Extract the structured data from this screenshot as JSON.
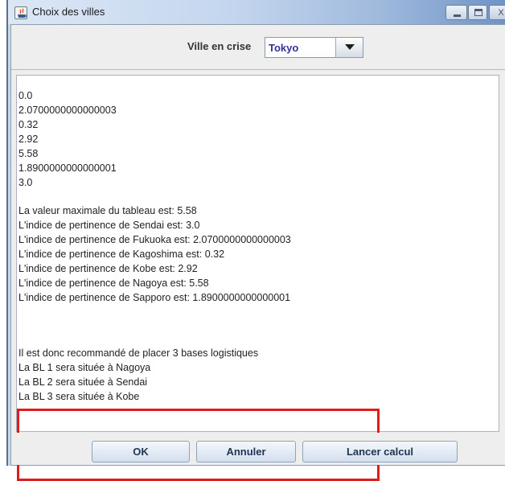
{
  "window": {
    "title": "Choix des villes",
    "icon": "java-app-icon",
    "controls": {
      "minimize": "minimize-icon",
      "maximize": "maximize-icon",
      "close": "close-icon",
      "close_glyph": "X"
    }
  },
  "header": {
    "label": "Ville en crise",
    "city_select": {
      "value": "Tokyo",
      "icon": "chevron-down-icon"
    }
  },
  "output": {
    "lines": [
      "0.0",
      "2.0700000000000003",
      "0.32",
      "2.92",
      "5.58",
      "1.8900000000000001",
      "3.0",
      "",
      "La valeur maximale du tableau est: 5.58",
      "L'indice de pertinence de Sendai est: 3.0",
      "L'indice de pertinence de Fukuoka est: 2.0700000000000003",
      "L'indice de pertinence de Kagoshima est: 0.32",
      "L'indice de pertinence de Kobe est: 2.92",
      "L'indice de pertinence de Nagoya est: 5.58",
      "L'indice de pertinence de Sapporo est: 1.8900000000000001",
      "",
      "",
      "",
      "Il est donc recommandé de placer 3 bases logistiques",
      "La BL 1 sera située à Nagoya",
      "La BL 2 sera située à Sendai",
      "La BL 3 sera située à Kobe"
    ],
    "highlight_color": "#e01b1b"
  },
  "buttons": {
    "ok": "OK",
    "annuler": "Annuler",
    "lancer_calcul": "Lancer calcul"
  }
}
